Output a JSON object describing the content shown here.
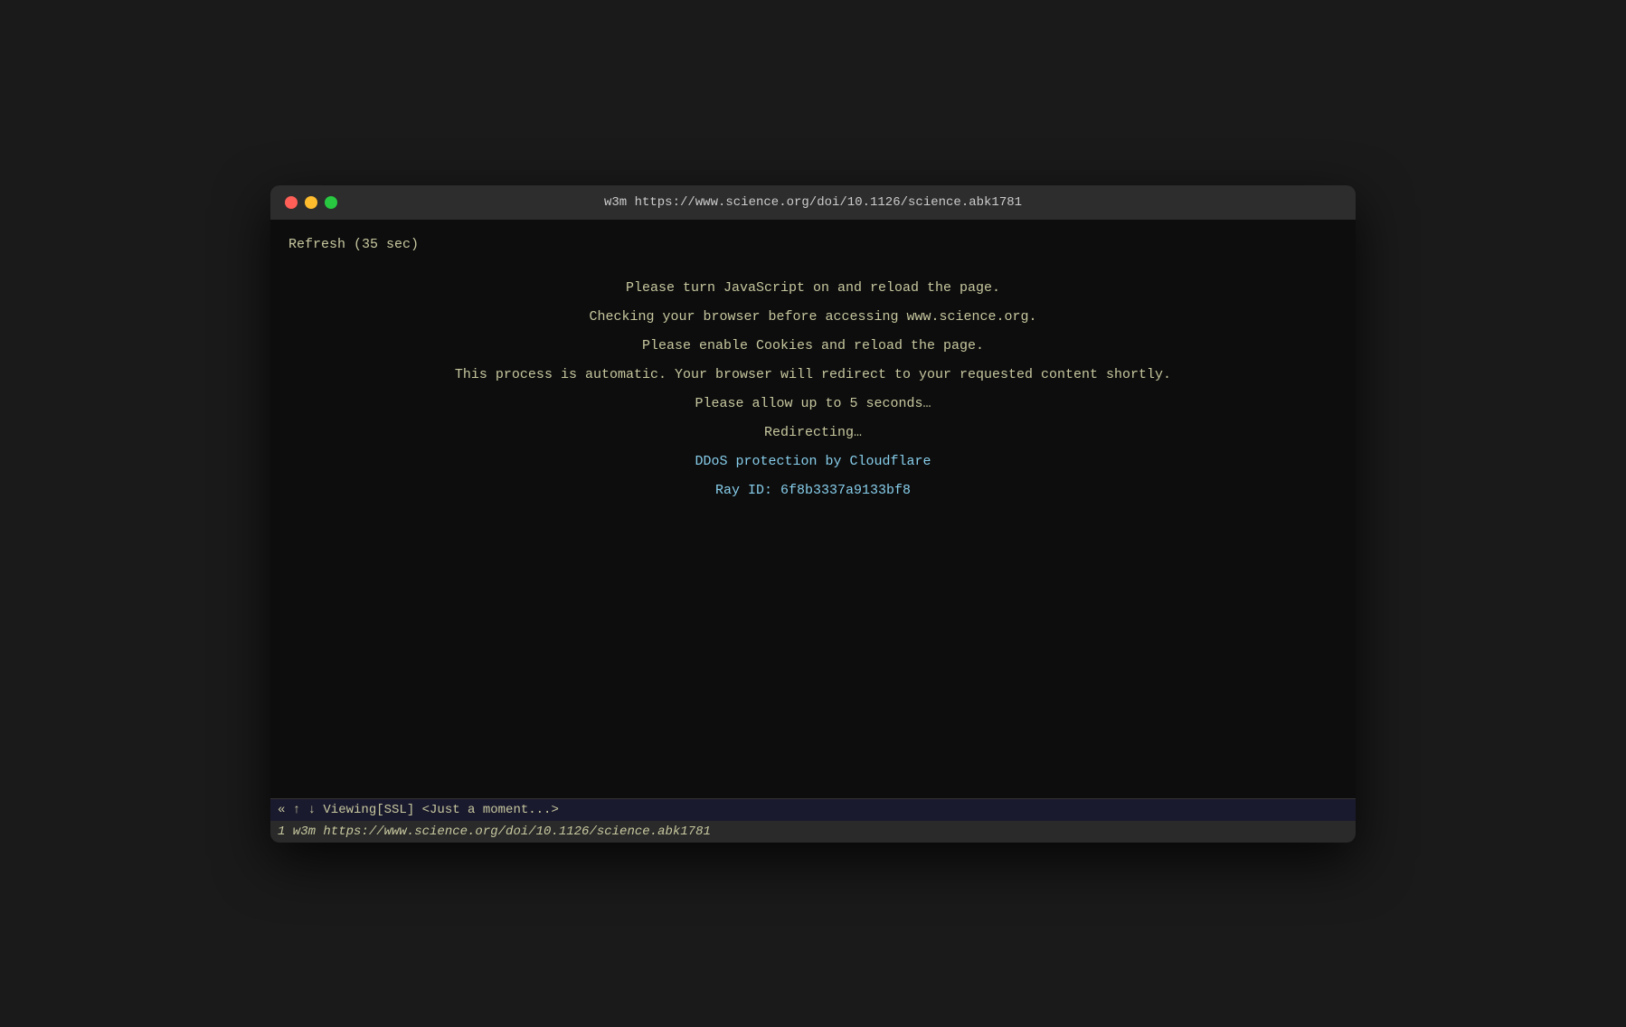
{
  "window": {
    "title": "w3m https://www.science.org/doi/10.1126/science.abk1781"
  },
  "terminal": {
    "refresh_line": "Refresh (35 sec)",
    "line1": "Please turn JavaScript on and reload the page.",
    "line2": "Checking your browser before accessing www.science.org.",
    "line3": "Please enable Cookies and reload the page.",
    "line4": "This process is automatic. Your browser will redirect to your requested content shortly.",
    "line5": "Please allow up to 5 seconds…",
    "line6": "Redirecting…",
    "line7": "DDoS protection by Cloudflare",
    "line8": "Ray ID: 6f8b3337a9133bf8"
  },
  "status_bar": {
    "top": "« ↑ ↓ Viewing[SSL] <Just a moment...>",
    "bottom": "1  w3m  https://www.science.org/doi/10.1126/science.abk1781"
  },
  "traffic_lights": {
    "close_color": "#ff5f57",
    "minimize_color": "#ffbd2e",
    "maximize_color": "#28c941"
  }
}
